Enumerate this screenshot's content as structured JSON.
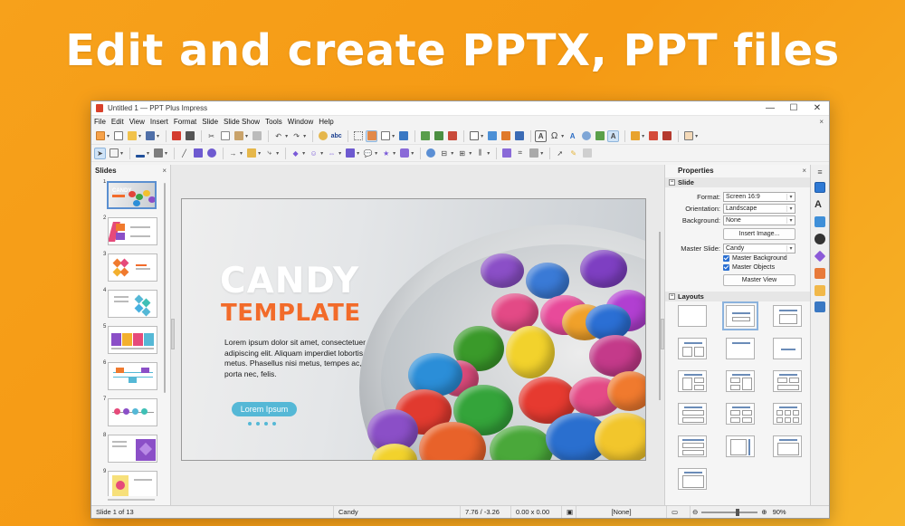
{
  "headline": "Edit and create PPTX, PPT files",
  "window": {
    "title": "Untitled 1 — PPT Plus Impress",
    "controls": {
      "minimize": "—",
      "maximize": "☐",
      "close": "✕"
    }
  },
  "menu": [
    "File",
    "Edit",
    "View",
    "Insert",
    "Format",
    "Slide",
    "Slide Show",
    "Tools",
    "Window",
    "Help"
  ],
  "menu_close": "×",
  "slides_panel": {
    "title": "Slides",
    "close": "×",
    "slide_numbers": [
      "1",
      "2",
      "3",
      "4",
      "5",
      "6",
      "7",
      "8",
      "9"
    ]
  },
  "slide": {
    "title": "CANDY",
    "subtitle": "TEMPLATE",
    "body": "Lorem ipsum dolor sit amet, consectetuer adipiscing elit. Aliquam imperdiet lobortis metus. Phasellus nisi metus, tempes ac, porta nec, felis.",
    "button": "Lorem Ipsum"
  },
  "properties": {
    "title": "Properties",
    "close": "×",
    "slide_section": "Slide",
    "format_label": "Format:",
    "format_value": "Screen 16:9",
    "orientation_label": "Orientation:",
    "orientation_value": "Landscape",
    "background_label": "Background:",
    "background_value": "None",
    "insert_image": "Insert Image...",
    "master_slide_label": "Master Slide:",
    "master_slide_value": "Candy",
    "master_background": "Master Background",
    "master_objects": "Master Objects",
    "master_view": "Master View",
    "layouts_section": "Layouts"
  },
  "status": {
    "slide": "Slide 1 of 13",
    "master": "Candy",
    "position": "7.76 / -3.26",
    "size": "0.00 x 0.00",
    "language": "[None]",
    "zoom": "90%"
  },
  "colors": {
    "background": "#f7a11b",
    "accent_orange": "#f26b2a",
    "accent_blue": "#55b8d6"
  }
}
